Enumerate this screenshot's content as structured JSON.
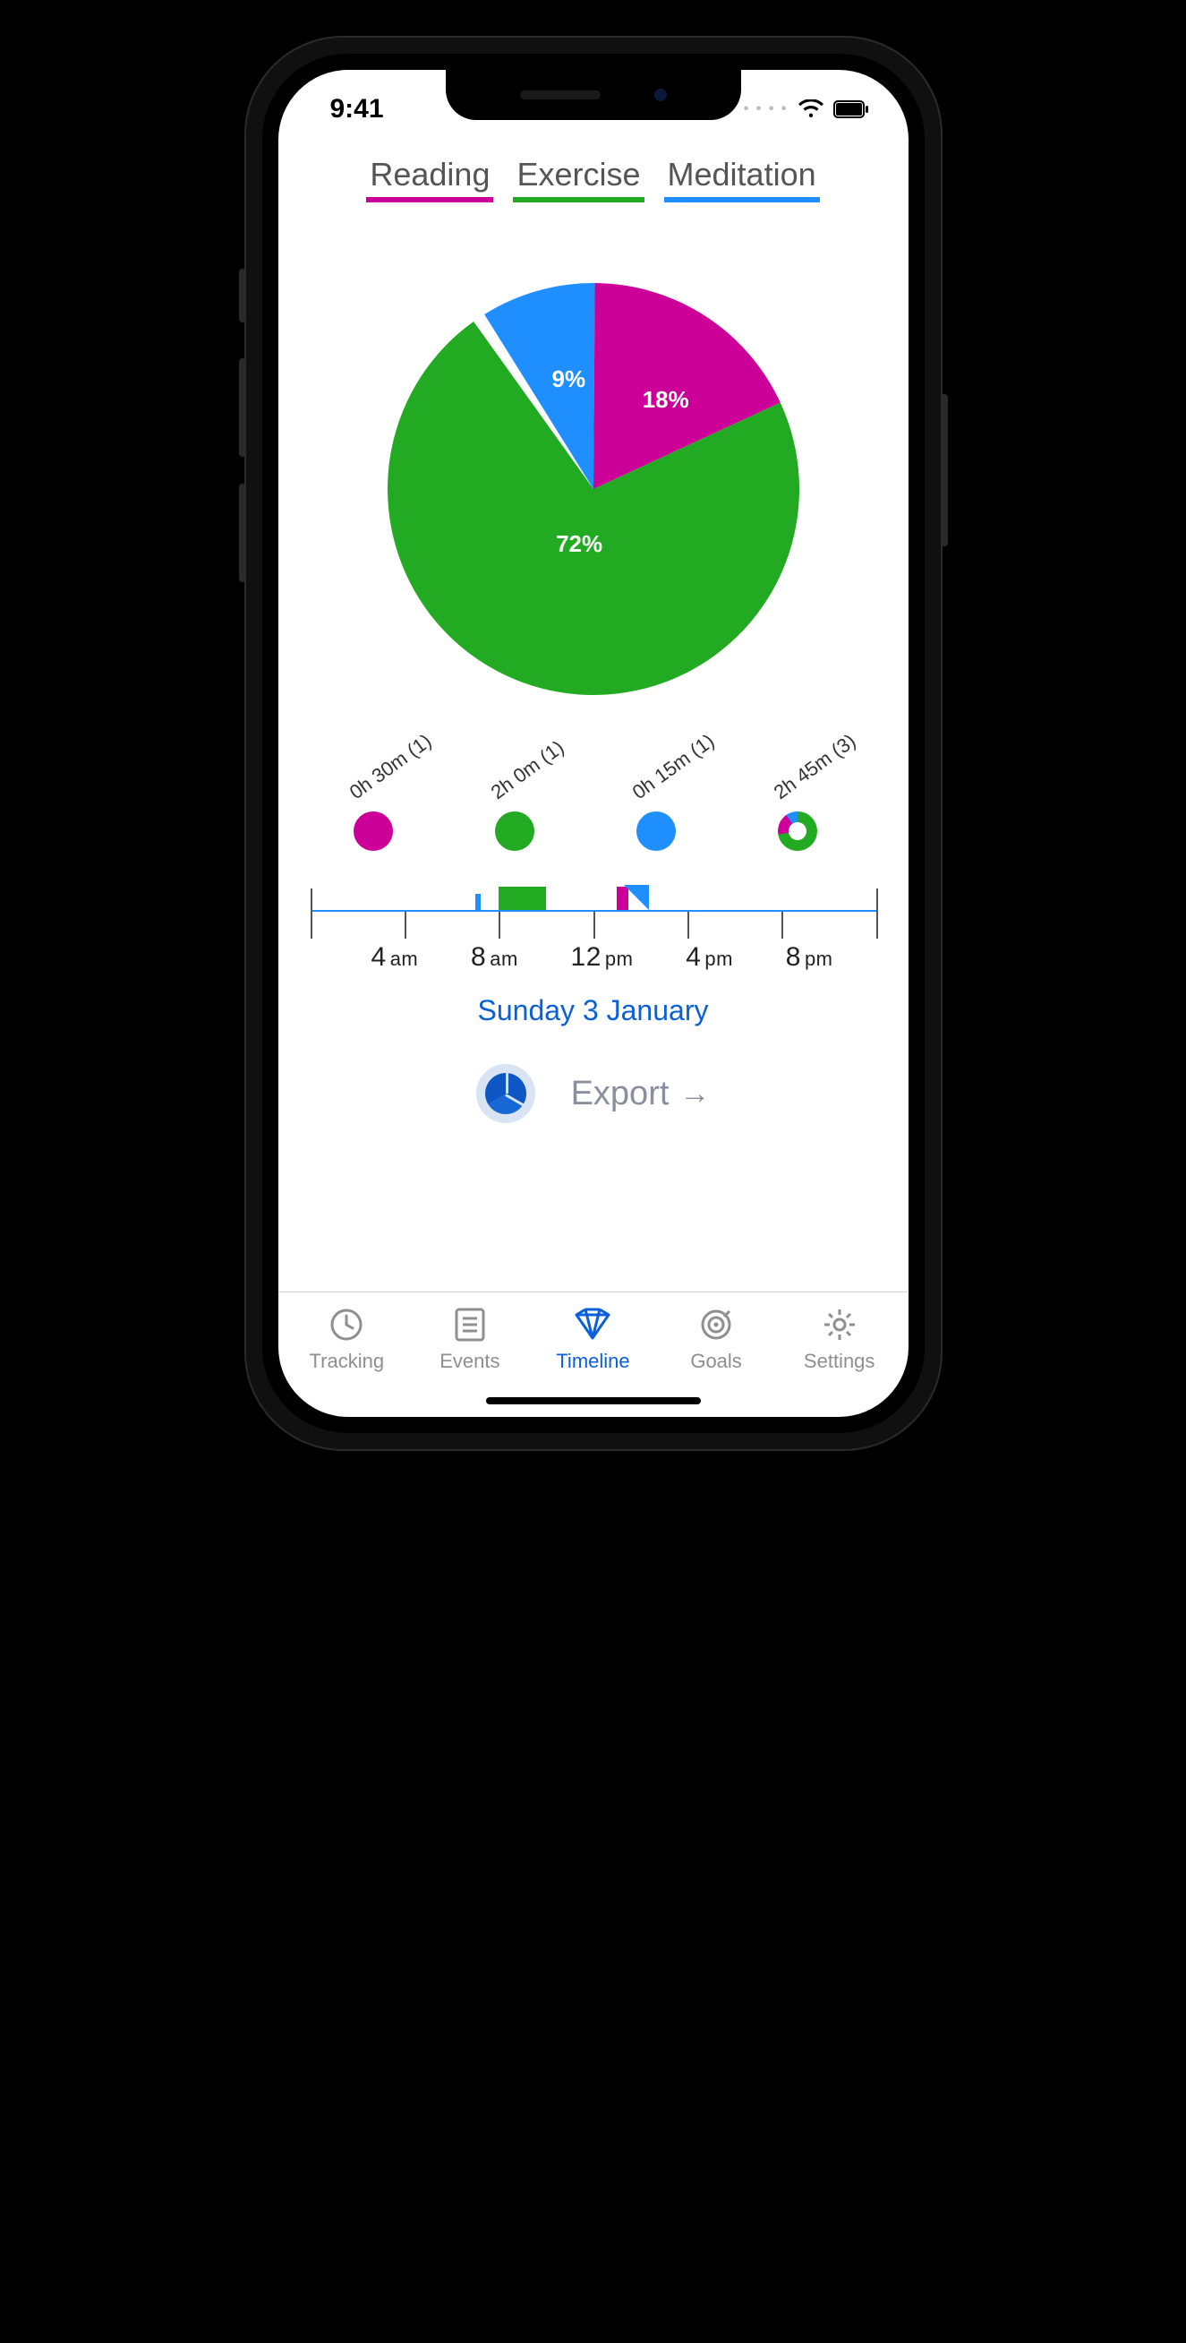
{
  "status": {
    "time": "9:41"
  },
  "legend": {
    "items": [
      {
        "label": "Reading",
        "color": "#cc0099"
      },
      {
        "label": "Exercise",
        "color": "#22aa22"
      },
      {
        "label": "Meditation",
        "color": "#1f8fff"
      }
    ]
  },
  "chart_data": {
    "type": "pie",
    "title": "",
    "series": [
      {
        "name": "Reading",
        "percent": 18,
        "label": "18%",
        "color": "#cc0099"
      },
      {
        "name": "Exercise",
        "percent": 72,
        "label": "72%",
        "color": "#22aa22"
      },
      {
        "name": "Meditation",
        "percent": 9,
        "label": "9%",
        "color": "#1f8fff"
      }
    ],
    "note": "remaining 1% is rounding gap"
  },
  "summary": {
    "items": [
      {
        "label": "0h 30m (1)",
        "kind": "reading"
      },
      {
        "label": "2h 0m (1)",
        "kind": "exercise"
      },
      {
        "label": "0h 15m (1)",
        "kind": "meditation"
      },
      {
        "label": "2h 45m (3)",
        "kind": "total"
      }
    ]
  },
  "timeline": {
    "axis_labels": [
      "4 am",
      "8 am",
      "12 pm",
      "4 pm",
      "8 pm"
    ],
    "date": "Sunday 3 January",
    "events": [
      {
        "kind": "meditation",
        "startHour": 7.0,
        "durHours": 0.25
      },
      {
        "kind": "exercise",
        "startHour": 8.0,
        "durHours": 2.0
      },
      {
        "kind": "reading",
        "startHour": 13.0,
        "durHours": 0.5
      },
      {
        "kind": "meditation_overlay",
        "startHour": 13.3,
        "durHours": 0.5
      }
    ],
    "range": {
      "startHour": 0,
      "endHour": 24
    }
  },
  "export": {
    "label": "Export",
    "arrow": "→"
  },
  "tabs": {
    "items": [
      {
        "label": "Tracking",
        "active": false
      },
      {
        "label": "Events",
        "active": false
      },
      {
        "label": "Timeline",
        "active": true
      },
      {
        "label": "Goals",
        "active": false
      },
      {
        "label": "Settings",
        "active": false
      }
    ]
  }
}
